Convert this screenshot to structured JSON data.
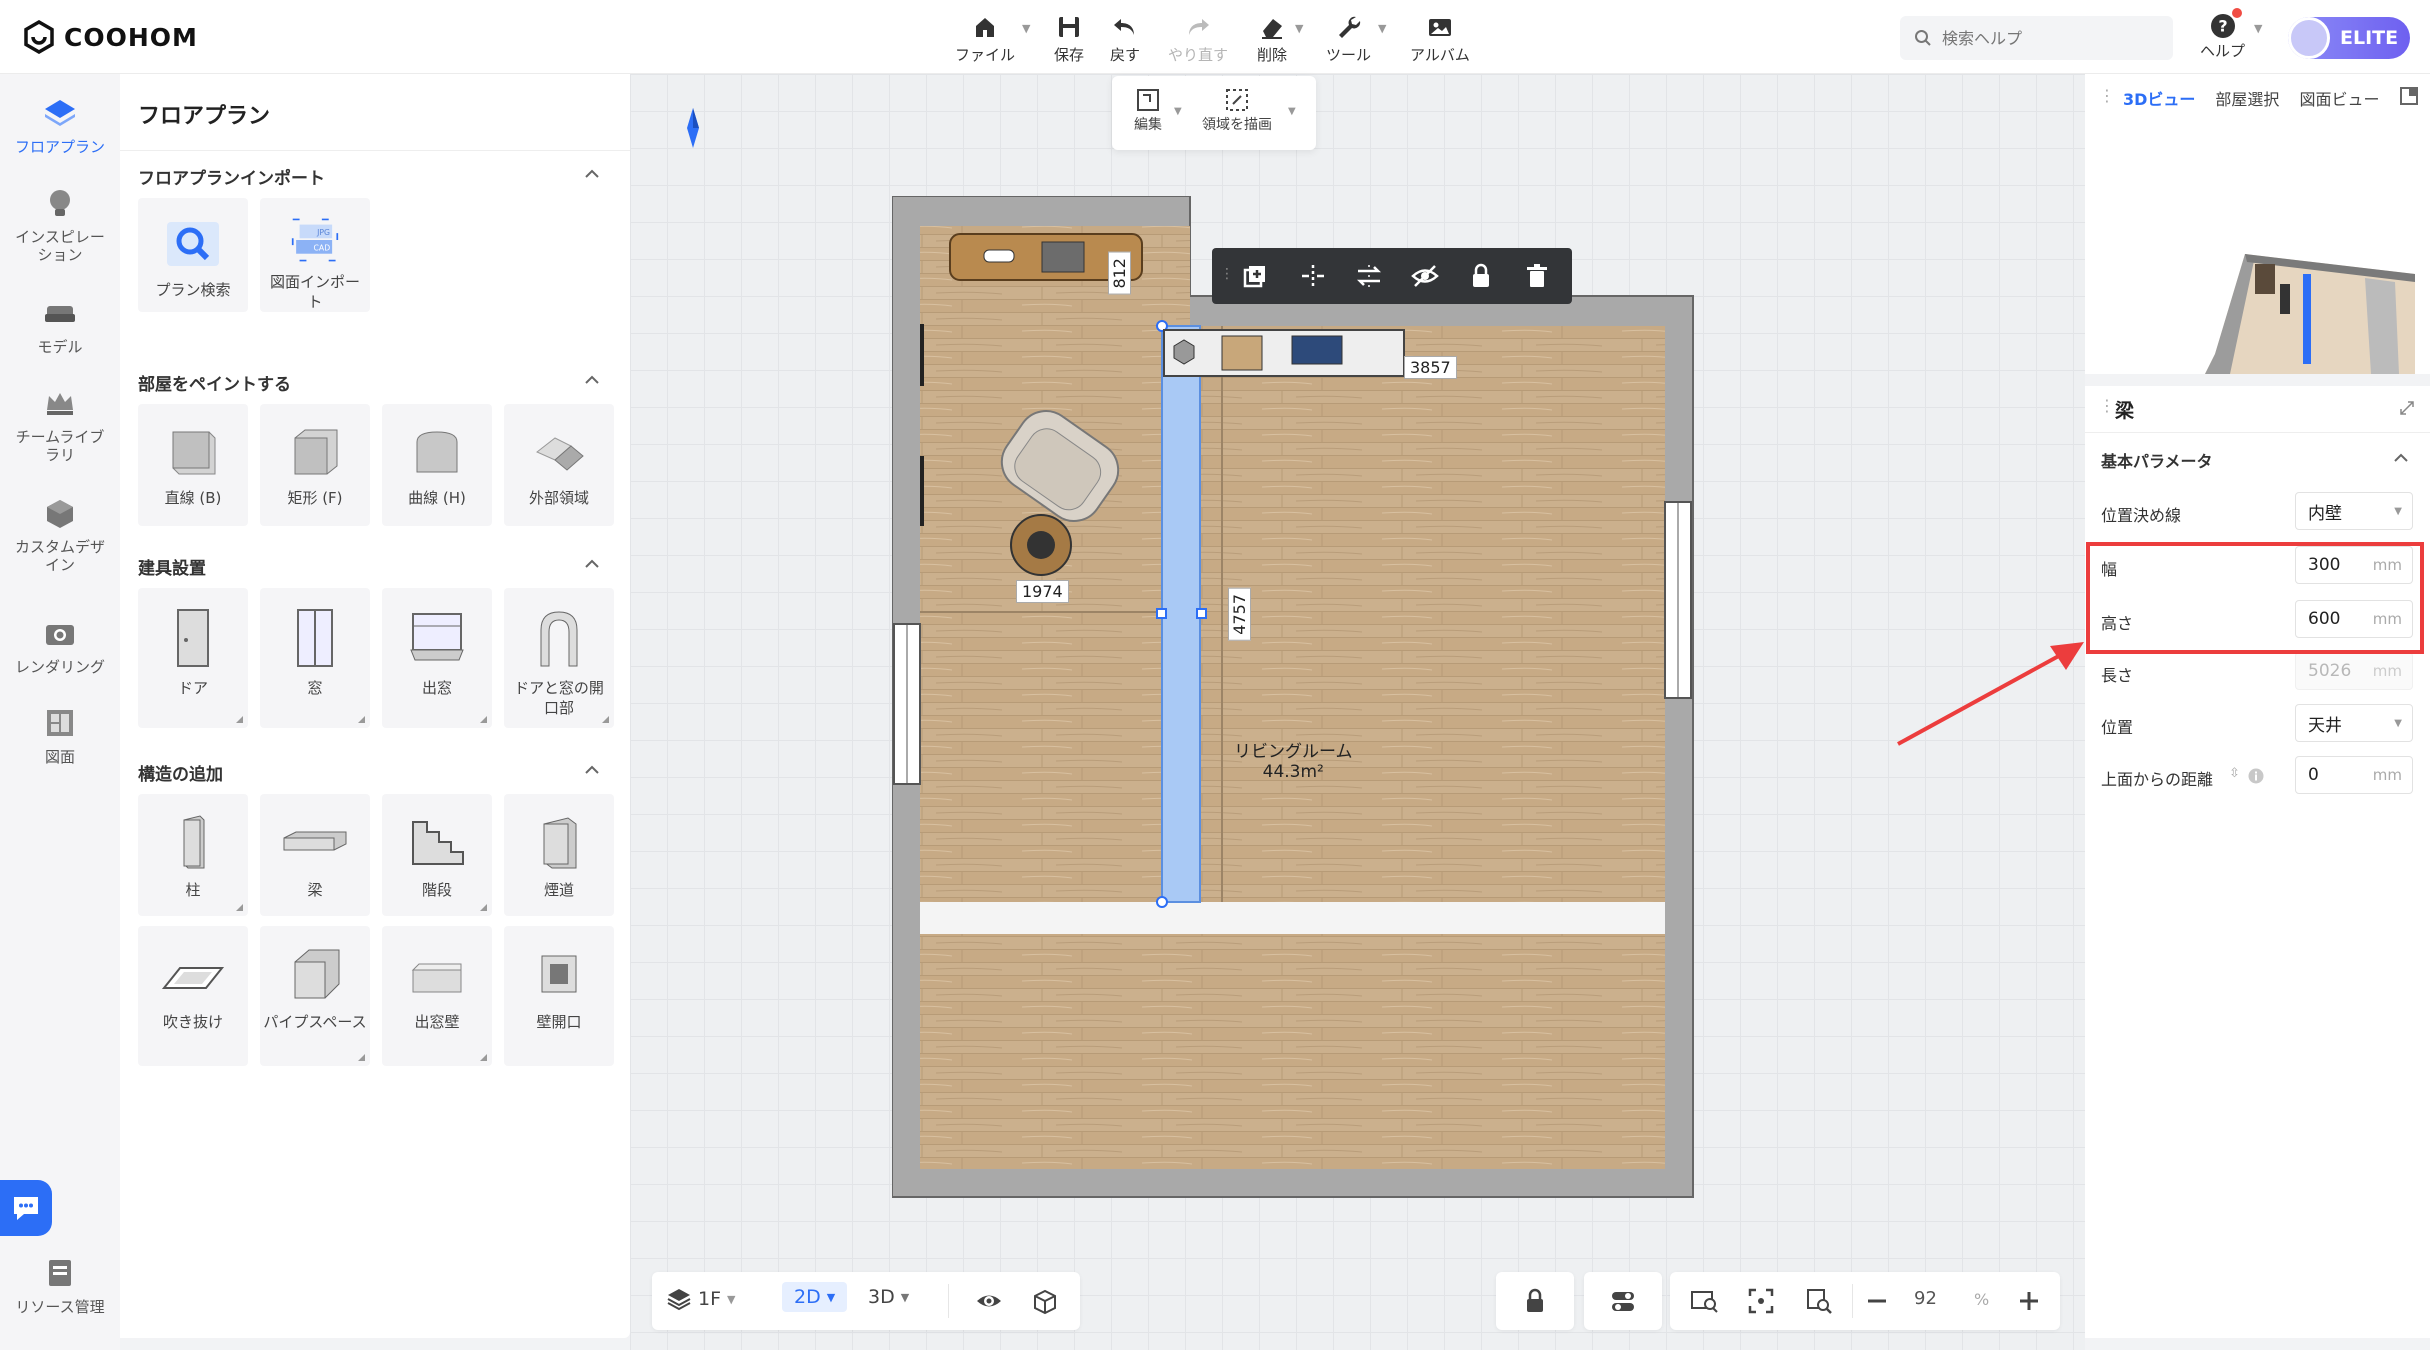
{
  "app": {
    "logo": "COOHOM"
  },
  "toolbar": {
    "file": "ファイル",
    "save": "保存",
    "undo": "戻す",
    "redo": "やり直す",
    "delete": "削除",
    "tools": "ツール",
    "album": "アルバム"
  },
  "search": {
    "placeholder": "検索ヘルプ"
  },
  "help": {
    "label": "ヘルプ"
  },
  "account": {
    "badge": "ELITE"
  },
  "rail": {
    "floorplan": "フロアプラン",
    "inspiration": "インスピレーション",
    "model": "モデル",
    "team_library": "チームライブラリ",
    "custom_design": "カスタムデザイン",
    "rendering": "レンダリング",
    "drawing": "図面",
    "resource": "リソース管理"
  },
  "panel": {
    "title": "フロアプラン",
    "import": {
      "title": "フロアプランインポート",
      "items": [
        "プラン検索",
        "図面インポート"
      ]
    },
    "paint": {
      "title": "部屋をペイントする",
      "items": [
        "直線 (B)",
        "矩形 (F)",
        "曲線 (H)",
        "外部領域"
      ]
    },
    "fixtures": {
      "title": "建具設置",
      "items": [
        "ドア",
        "窓",
        "出窓",
        "ドアと窓の開口部"
      ]
    },
    "structure": {
      "title": "構造の追加",
      "items": [
        "柱",
        "梁",
        "階段",
        "煙道",
        "吹き抜け",
        "パイプスペース",
        "出窓壁",
        "壁開口"
      ]
    }
  },
  "canvas_bar": {
    "edit": "編集",
    "draw_area": "領域を描画"
  },
  "plan": {
    "dims": {
      "top": "812",
      "right_top": "3857",
      "left": "1974",
      "beam": "4757"
    },
    "room_name": "リビングルーム",
    "room_area": "44.3m²"
  },
  "bottom": {
    "floor": "1F",
    "mode_2d": "2D",
    "mode_3d": "3D",
    "zoom": "92",
    "zoom_unit": "%"
  },
  "right": {
    "tabs": [
      "3Dビュー",
      "部屋選択",
      "図面ビュー"
    ],
    "object_title": "梁",
    "section": "基本パラメータ",
    "params": {
      "anchor": {
        "label": "位置決め線",
        "value": "内壁"
      },
      "width": {
        "label": "幅",
        "value": "300",
        "unit": "mm"
      },
      "height": {
        "label": "高さ",
        "value": "600",
        "unit": "mm"
      },
      "length": {
        "label": "長さ",
        "value": "5026",
        "unit": "mm"
      },
      "position": {
        "label": "位置",
        "value": "天井"
      },
      "offset": {
        "label": "上面からの距離",
        "value": "0",
        "unit": "mm"
      }
    }
  },
  "colors": {
    "accent": "#2c6ef6",
    "highlight": "#ec3d3d",
    "beam": "#a9c9f5"
  }
}
